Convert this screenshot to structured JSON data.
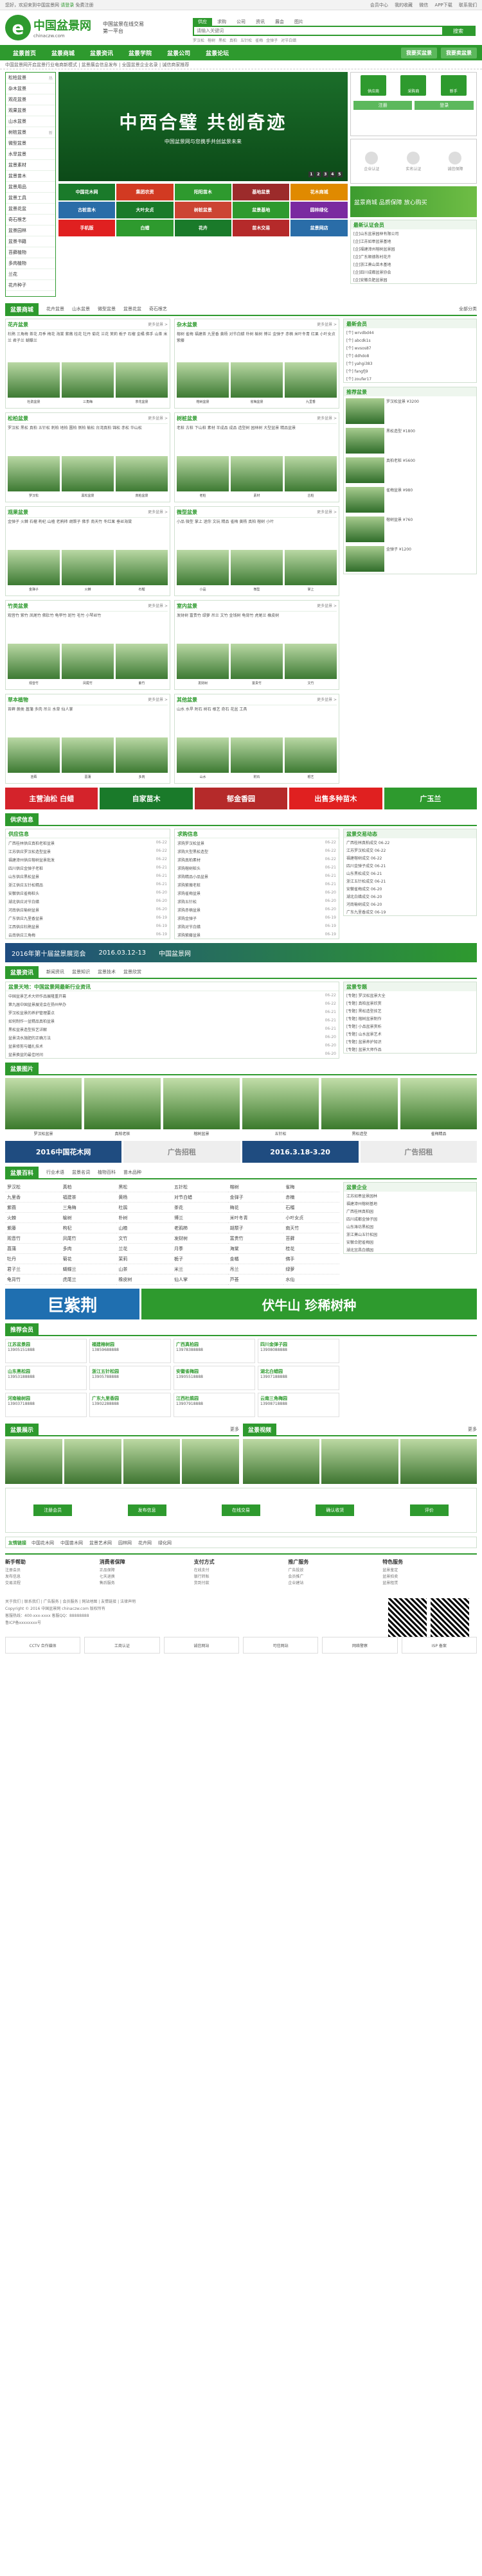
{
  "topbar": {
    "welcome": "您好，欢迎来到中国盆景网",
    "login": "请登录",
    "register": "免费注册",
    "links": [
      "会员中心",
      "我的收藏",
      "微信",
      "APP下载",
      "联系我们"
    ]
  },
  "header": {
    "logo_cn": "中国盆景网",
    "logo_en": "chinaczw.com",
    "slogan": "中国盆景在线交易第一平台"
  },
  "search": {
    "tabs": [
      "供应",
      "求购",
      "公司",
      "资讯",
      "展会",
      "图片"
    ],
    "placeholder": "请输入关键词",
    "button": "搜索",
    "hot": [
      "罗汉松",
      "榕树",
      "黑松",
      "真柏",
      "五针松",
      "雀梅",
      "金弹子",
      "对节白蜡"
    ]
  },
  "nav": {
    "items": [
      "盆景首页",
      "盆景商城",
      "盆景资讯",
      "盆景学院",
      "盆景公司",
      "盆景论坛"
    ],
    "btn1": "我要买盆景",
    "btn2": "我要卖盆景"
  },
  "notice": "中国盆景网开启盆景行业电商新模式 | 盆景展会信息发布 | 全国盆景企业名录 | 诚信商家推荐",
  "categories": [
    {
      "name": "松柏盆景",
      "hot": "热"
    },
    {
      "name": "杂木盆景",
      "hot": ""
    },
    {
      "name": "观花盆景",
      "hot": ""
    },
    {
      "name": "观果盆景",
      "hot": ""
    },
    {
      "name": "山水盆景",
      "hot": ""
    },
    {
      "name": "树桩盆景",
      "hot": "新"
    },
    {
      "name": "微型盆景",
      "hot": ""
    },
    {
      "name": "水旱盆景",
      "hot": ""
    },
    {
      "name": "盆景素材",
      "hot": ""
    },
    {
      "name": "盆景苗木",
      "hot": ""
    },
    {
      "name": "盆景用品",
      "hot": ""
    },
    {
      "name": "盆景工具",
      "hot": ""
    },
    {
      "name": "盆景花盆",
      "hot": ""
    },
    {
      "name": "奇石根艺",
      "hot": ""
    },
    {
      "name": "盆景园林",
      "hot": ""
    },
    {
      "name": "盆景书籍",
      "hot": ""
    },
    {
      "name": "苔藓植物",
      "hot": ""
    },
    {
      "name": "多肉植物",
      "hot": ""
    },
    {
      "name": "兰花",
      "hot": ""
    },
    {
      "name": "花卉种子",
      "hot": ""
    }
  ],
  "banner": {
    "big": "中西合璧  共创奇迹",
    "small": "中国盆景网与您携手共创盆景未来",
    "dots": [
      "1",
      "2",
      "3",
      "4",
      "5"
    ]
  },
  "login": {
    "icons": [
      "供应商",
      "采购商",
      "新手"
    ],
    "buttons": [
      "注册",
      "登录"
    ]
  },
  "rightinfo": {
    "items": [
      "企业认证",
      "实名认证",
      "诚信保障"
    ]
  },
  "greenbanner": "盆景商城 品质保障 放心购买",
  "ads": [
    {
      "t": "中国花木网",
      "c": "#1a7a2a"
    },
    {
      "t": "集团农资",
      "c": "#d23a22"
    },
    {
      "t": "阳阳苗木",
      "c": "#2e9a2e"
    },
    {
      "t": "基地盆景",
      "c": "#9c2b2b"
    },
    {
      "t": "花木商城",
      "c": "#e08a00"
    },
    {
      "t": "古桩苗木",
      "c": "#2a6da8"
    },
    {
      "t": "大叶女贞",
      "c": "#1a7a2a"
    },
    {
      "t": "树桩盆景",
      "c": "#c43"
    },
    {
      "t": "盆景基地",
      "c": "#2e9a2e"
    },
    {
      "t": "园林绿化",
      "c": "#7a2aa0"
    },
    {
      "t": "手机版",
      "c": "#e02020"
    },
    {
      "t": "白蜡",
      "c": "#2e9a2e"
    },
    {
      "t": "花卉",
      "c": "#1a7a2a"
    },
    {
      "t": "苗木交易",
      "c": "#b52a2a"
    },
    {
      "t": "盆景网店",
      "c": "#2a6da8"
    }
  ],
  "mall": {
    "title": "盆景商城",
    "tabs": [
      "花卉盆景",
      "山水盆景",
      "微型盆景",
      "盆景花盆",
      "奇石根艺",
      "全部分类"
    ],
    "more": "更多"
  },
  "plantboxes": [
    {
      "title": "花卉盆景",
      "more": "更多盆景 >",
      "tags": "杜鹃 三角梅 茶花 月季 梅花 海棠 紫薇 桂花 牡丹 菊花 兰花 茉莉 栀子 石榴 金橘 佛手 山茶 米兰 君子兰 蝴蝶兰",
      "imgs": [
        "杜鹃盆景",
        "三角梅",
        "茶花盆景"
      ]
    },
    {
      "title": "杂木盆景",
      "more": "更多盆景 >",
      "tags": "榕树 雀梅 福建茶 九里香 黄杨 对节白蜡 朴树 榆树 博兰 金弹子 赤楠 米叶冬青 红果 小叶女贞 紫藤",
      "imgs": [
        "榕树盆景",
        "雀梅盆景",
        "九里香"
      ]
    },
    {
      "title": "松柏盆景",
      "more": "更多盆景 >",
      "tags": "罗汉松 黑松 真柏 五针松 刺柏 地柏 圆柏 侧柏 榆松 台湾真柏 锦松 赤松 华山松",
      "imgs": [
        "罗汉松",
        "黑松盆景",
        "真柏盆景"
      ]
    },
    {
      "title": "树桩盆景",
      "more": "更多盆景 >",
      "tags": "老桩 古桩 下山桩 素材 半成品 成品 造型树 园林树 大型盆景 精品盆景",
      "imgs": [
        "老桩",
        "素材",
        "古桩"
      ]
    },
    {
      "title": "观果盆景",
      "more": "更多盆景 >",
      "tags": "金弹子 火棘 石榴 枸杞 山楂 老鸦柿 胡颓子 佛手 南天竹 冬红果 垂丝海棠",
      "imgs": [
        "金弹子",
        "火棘",
        "石榴"
      ]
    },
    {
      "title": "微型盆景",
      "more": "更多盆景 >",
      "tags": "小品 微型 掌上 迷你 文玩 精品 雀梅 黄杨 真柏 榕树 小叶",
      "imgs": [
        "小品",
        "微型",
        "掌上"
      ]
    },
    {
      "title": "竹类盆景",
      "more": "更多盆景 >",
      "tags": "观音竹 紫竹 凤尾竹 佛肚竹 龟甲竹 斑竹 毛竹 小琴丝竹",
      "imgs": [
        "观音竹",
        "凤尾竹",
        "紫竹"
      ]
    },
    {
      "title": "室内盆景",
      "more": "更多盆景 >",
      "tags": "发财树 富贵竹 绿萝 吊兰 文竹 金钱树 龟背竹 虎尾兰 橡皮树",
      "imgs": [
        "发财树",
        "富贵竹",
        "文竹"
      ]
    },
    {
      "title": "草本植物",
      "more": "更多盆景 >",
      "tags": "苔藓 蕨类 菖蒲 多肉 吊兰 水草 仙人掌",
      "imgs": [
        "苔藓",
        "菖蒲",
        "多肉"
      ]
    },
    {
      "title": "其他盆景",
      "more": "更多盆景 >",
      "tags": "山水 水旱 附石 树石 根艺 奇石 花盆 工具",
      "imgs": [
        "山水",
        "附石",
        "根艺"
      ]
    }
  ],
  "side1": {
    "title": "最新认证会员",
    "items": [
      "[企]山东盆景园林有限公司",
      "[企]江苏如皋盆景基地",
      "[企]福建漳州榕树盆景园",
      "[企]广东顺德陈村花卉",
      "[企]浙江萧山苗木基地",
      "[企]四川成都盆景协会",
      "[企]安徽合肥盆景园"
    ]
  },
  "side2": {
    "title": "最新会员",
    "items": [
      "[个] wrvdbd44",
      "[个] abcdk1s",
      "[个] wvsos87",
      "[个] ddhdo8",
      "[个] yahgi383",
      "[个] fangfj9",
      "[个] zoufer17"
    ]
  },
  "side3": {
    "title": "推荐盆景",
    "items": [
      "罗汉松盆景 ¥3200",
      "黑松造型 ¥1800",
      "真柏老桩 ¥5600",
      "雀梅盆景 ¥980",
      "榕树盆景 ¥760",
      "金弹子 ¥1200"
    ]
  },
  "strip": [
    {
      "t": "主营油松 白蜡",
      "c": "#d4232b"
    },
    {
      "t": "自家苗木",
      "c": "#1a7a2a"
    },
    {
      "t": "郁金香园",
      "c": "#b52a2a"
    },
    {
      "t": "出售多种苗木",
      "c": "#e02020"
    },
    {
      "t": "广玉兰",
      "c": "#2e9a2e"
    }
  ],
  "supply": {
    "title": "供求信息",
    "left_h": "供应信息",
    "right_h": "求购信息",
    "left": [
      {
        "t": "广西桂林供应真柏老桩盆景",
        "d": "06-22"
      },
      {
        "t": "江苏供应罗汉松造型盆景",
        "d": "06-22"
      },
      {
        "t": "福建漳州供应榕树盆景批发",
        "d": "06-22"
      },
      {
        "t": "四川供应金弹子老桩",
        "d": "06-21"
      },
      {
        "t": "山东供应黑松盆景",
        "d": "06-21"
      },
      {
        "t": "浙江供应五针松精品",
        "d": "06-21"
      },
      {
        "t": "安徽供应雀梅桩头",
        "d": "06-20"
      },
      {
        "t": "湖北供应对节白蜡",
        "d": "06-20"
      },
      {
        "t": "河南供应榆树盆景",
        "d": "06-20"
      },
      {
        "t": "广东供应九里香盆景",
        "d": "06-19"
      },
      {
        "t": "江西供应杜鹃盆景",
        "d": "06-19"
      },
      {
        "t": "云南供应三角梅",
        "d": "06-19"
      }
    ],
    "right": [
      {
        "t": "求购罗汉松盆景",
        "d": "06-22"
      },
      {
        "t": "求购大型黑松造型",
        "d": "06-22"
      },
      {
        "t": "求购真柏素材",
        "d": "06-22"
      },
      {
        "t": "求购榕树桩头",
        "d": "06-21"
      },
      {
        "t": "求购精品小品盆景",
        "d": "06-21"
      },
      {
        "t": "求购紫薇老桩",
        "d": "06-21"
      },
      {
        "t": "求购雀梅盆景",
        "d": "06-20"
      },
      {
        "t": "求购五针松",
        "d": "06-20"
      },
      {
        "t": "求购赤楠盆景",
        "d": "06-20"
      },
      {
        "t": "求购金弹子",
        "d": "06-19"
      },
      {
        "t": "求购对节白蜡",
        "d": "06-19"
      },
      {
        "t": "求购紫藤盆景",
        "d": "06-19"
      }
    ]
  },
  "side4": {
    "title": "盆景交易动态",
    "items": [
      "广西桂林真柏成交 06-22",
      "江苏罗汉松成交 06-22",
      "福建榕树成交 06-22",
      "四川金弹子成交 06-21",
      "山东黑松成交 06-21",
      "浙江五针松成交 06-21",
      "安徽雀梅成交 06-20",
      "湖北白蜡成交 06-20",
      "河南榆树成交 06-20",
      "广东九里香成交 06-19"
    ]
  },
  "widebanner": [
    "2016年第十届盆景展览会",
    "2016.03.12-13",
    "中国盆景网"
  ],
  "news": {
    "title": "盆景资讯",
    "tabs": [
      "新闻资讯",
      "盆景知识",
      "盆景技术",
      "盆景欣赏"
    ],
    "headline": "盆景天地：中国盆景网最新行业资讯",
    "items": [
      {
        "t": "中国盆景艺术大师作品展隆重开幕",
        "d": "06-22"
      },
      {
        "t": "第九届中国盆景展览会在扬州举办",
        "d": "06-22"
      },
      {
        "t": "罗汉松盆景的养护管理要点",
        "d": "06-21"
      },
      {
        "t": "如何制作一盆精品真柏盆景",
        "d": "06-21"
      },
      {
        "t": "黑松盆景造型技艺详解",
        "d": "06-21"
      },
      {
        "t": "盆景浇水施肥的正确方法",
        "d": "06-20"
      },
      {
        "t": "盆景修剪与蟠扎技术",
        "d": "06-20"
      },
      {
        "t": "盆景换盆的最佳时间",
        "d": "06-20"
      }
    ]
  },
  "side5": {
    "title": "盆景专题",
    "items": [
      "[专题] 罗汉松盆景大全",
      "[专题] 真柏盆景欣赏",
      "[专题] 黑松造型技艺",
      "[专题] 榕树盆景制作",
      "[专题] 小品盆景赏析",
      "[专题] 山水盆景艺术",
      "[专题] 盆景养护知识",
      "[专题] 盆景大师作品"
    ]
  },
  "gallery": {
    "title": "盆景图片",
    "items": [
      "罗汉松盆景",
      "真柏老桩",
      "榕树盆景",
      "五针松",
      "黑松造型",
      "雀梅精品"
    ]
  },
  "gbanner": [
    {
      "t": "2016中国花木网",
      "c": "#1f4c80"
    },
    {
      "t": "广告招租",
      "c": "#eee"
    },
    {
      "t": "2016.3.18-3.20",
      "c": "#1f4c80"
    },
    {
      "t": "广告招租",
      "c": "#eee"
    }
  ],
  "directory": {
    "title": "盆景百科",
    "tabs": [
      "盆景百科",
      "行业术语",
      "盆景名词",
      "植物百科",
      "苗木品种"
    ],
    "items": [
      "罗汉松",
      "真柏",
      "黑松",
      "五针松",
      "榕树",
      "雀梅",
      "九里香",
      "福建茶",
      "黄杨",
      "对节白蜡",
      "金弹子",
      "赤楠",
      "紫薇",
      "三角梅",
      "杜鹃",
      "茶花",
      "梅花",
      "石榴",
      "火棘",
      "榆树",
      "朴树",
      "博兰",
      "米叶冬青",
      "小叶女贞",
      "紫藤",
      "枸杞",
      "山楂",
      "老鸦柿",
      "胡颓子",
      "南天竹",
      "观音竹",
      "凤尾竹",
      "文竹",
      "发财树",
      "富贵竹",
      "苔藓",
      "菖蒲",
      "多肉",
      "兰花",
      "月季",
      "海棠",
      "桂花",
      "牡丹",
      "菊花",
      "茉莉",
      "栀子",
      "金橘",
      "佛手",
      "君子兰",
      "蝴蝶兰",
      "山茶",
      "米兰",
      "吊兰",
      "绿萝",
      "龟背竹",
      "虎尾兰",
      "橡皮树",
      "仙人掌",
      "芦荟",
      "水仙"
    ]
  },
  "bigbanner": [
    "巨紫荆",
    "伏牛山 珍稀树种"
  ],
  "members": {
    "title": "推荐会员",
    "items": [
      {
        "n": "江苏盆景园",
        "p": "13905151888"
      },
      {
        "n": "福建榕树园",
        "p": "13859688888"
      },
      {
        "n": "广西真柏园",
        "p": "13978388888"
      },
      {
        "n": "四川金弹子园",
        "p": "13908088888"
      },
      {
        "n": "山东黑松园",
        "p": "13953188888"
      },
      {
        "n": "浙江五针松园",
        "p": "13905788888"
      },
      {
        "n": "安徽雀梅园",
        "p": "13905518888"
      },
      {
        "n": "湖北白蜡园",
        "p": "13907188888"
      },
      {
        "n": "河南榆树园",
        "p": "13903718888"
      },
      {
        "n": "广东九里香园",
        "p": "13902288888"
      },
      {
        "n": "江西杜鹃园",
        "p": "13907918888"
      },
      {
        "n": "云南三角梅园",
        "p": "13908718888"
      }
    ]
  },
  "side6": {
    "title": "盆景企业",
    "items": [
      "江苏如皋盆景园林",
      "福建漳州榕树基地",
      "广西桂林真柏园",
      "四川成都金弹子园",
      "山东潍坊黑松园",
      "浙江萧山五针松园",
      "安徽合肥雀梅园",
      "湖北宜昌白蜡园"
    ]
  },
  "shows": [
    {
      "title": "盆景展示",
      "more": "更多"
    },
    {
      "title": "盆景视频",
      "more": "更多"
    }
  ],
  "flow": [
    "注册会员",
    "发布信息",
    "在线交易",
    "确认收货",
    "评价"
  ],
  "friendlinks": {
    "label": "友情链接",
    "items": [
      "中国花木网",
      "中国苗木网",
      "盆景艺术网",
      "园林网",
      "花卉网",
      "绿化网"
    ]
  },
  "help": [
    {
      "t": "新手帮助",
      "i": [
        "注册会员",
        "发布信息",
        "交易流程"
      ]
    },
    {
      "t": "消费者保障",
      "i": [
        "正品保障",
        "七天退换",
        "售后服务"
      ]
    },
    {
      "t": "支付方式",
      "i": [
        "在线支付",
        "银行转账",
        "货到付款"
      ]
    },
    {
      "t": "推广服务",
      "i": [
        "广告投放",
        "会员推广",
        "企业建站"
      ]
    },
    {
      "t": "特色服务",
      "i": [
        "盆景鉴定",
        "盆景拍卖",
        "盆景租赁"
      ]
    }
  ],
  "footer": [
    "关于我们 | 联系我们 | 广告服务 | 会员服务 | 网站地图 | 友情链接 | 法律声明",
    "Copyright © 2016 中国盆景网 chinaczw.com 版权所有",
    "客服热线：400-xxx-xxxx  客服QQ：88888888",
    "鲁ICP备xxxxxxxx号"
  ],
  "badges": [
    "CCTV 合作媒体",
    "工商认证",
    "诚信网站",
    "可信网站",
    "网络警察",
    "ISP 备案"
  ]
}
